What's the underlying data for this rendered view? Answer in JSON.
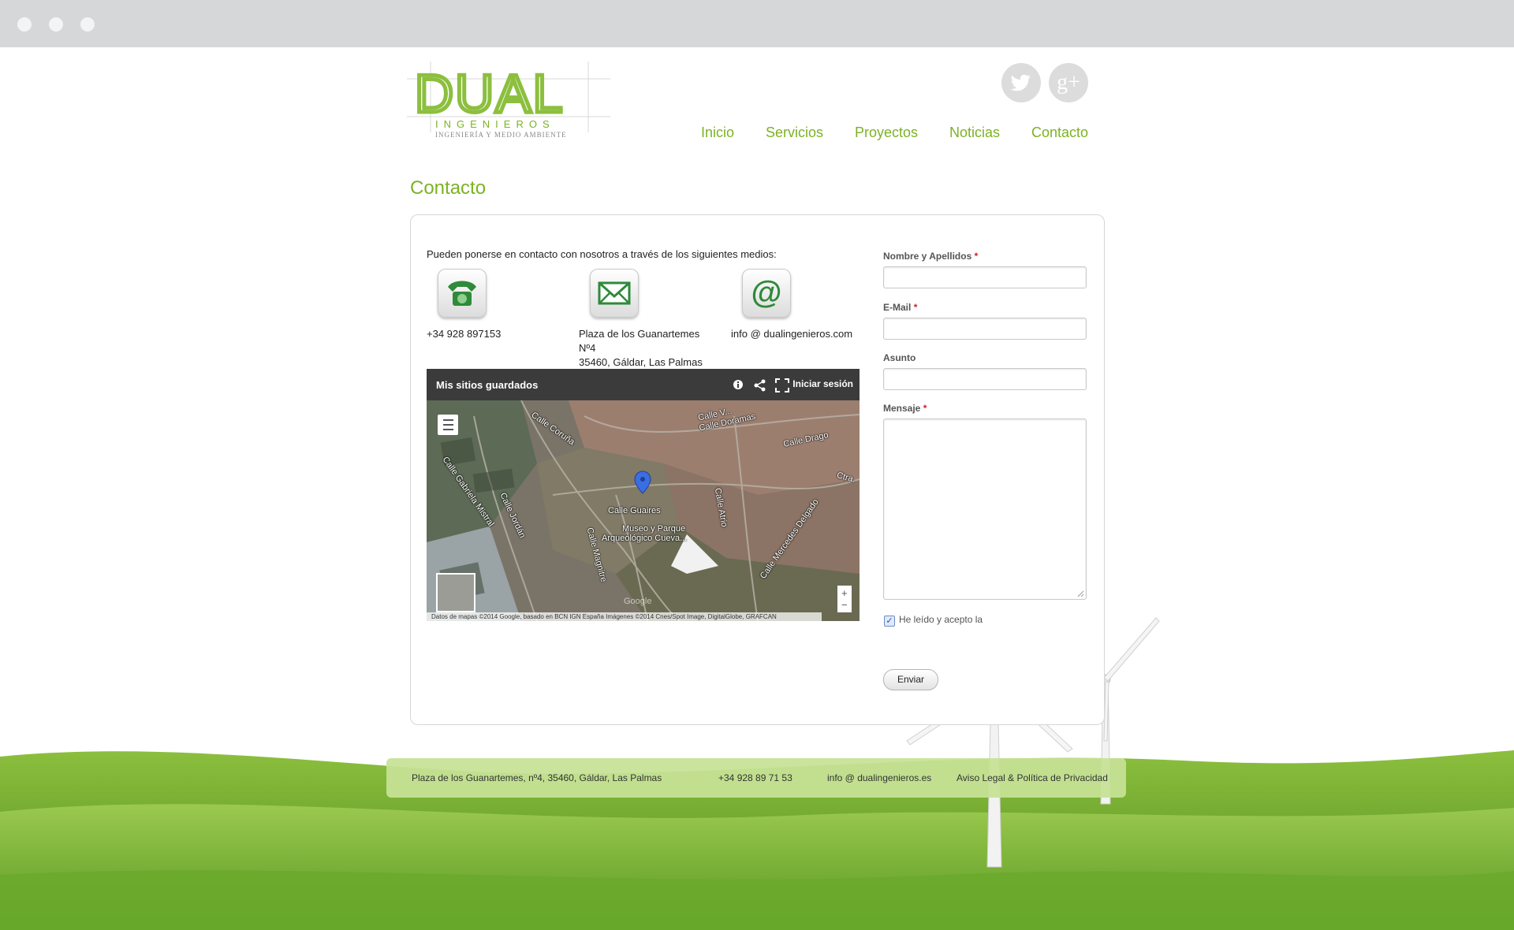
{
  "header": {
    "logo_text": "DUAL",
    "logo_subtitle": "INGENIEROS",
    "logo_tagline": "INGENIERÍA Y MEDIO AMBIENTE",
    "social": [
      {
        "name": "twitter-icon"
      },
      {
        "name": "google-plus-icon",
        "label": "g+"
      }
    ],
    "nav": [
      {
        "label": "Inicio"
      },
      {
        "label": "Servicios"
      },
      {
        "label": "Proyectos"
      },
      {
        "label": "Noticias"
      },
      {
        "label": "Contacto"
      }
    ]
  },
  "page": {
    "title": "Contacto",
    "intro": "Pueden ponerse en contacto con nosotros a través de los siguientes medios:",
    "contacts": {
      "phone": "+34 928 897153",
      "address_line1": "Plaza de los Guanartemes",
      "address_line2": "Nº4",
      "address_line3": "35460, Gáldar, Las Palmas",
      "email": "info @ dualingenieros.com"
    }
  },
  "map": {
    "title": "Mis sitios guardados",
    "signin": "Iniciar sesión",
    "labels": {
      "calle_coruna": "Calle Coruña",
      "calle_doramas": "Calle Doramas",
      "calle_drago": "Calle Drago",
      "calle_gabriela_mistral": "Calle Gabriela Mistral",
      "calle_jordan": "Calle Jordán",
      "calle_guaires": "Calle Guaires",
      "museo_1": "Museo y Parque",
      "museo_2": "Arqueológico Cueva...",
      "calle_magnitre": "Calle Magnitre",
      "calle_mercedes": "Calle Mercedes Delgado",
      "calle_atrio": "Calle Atrio",
      "calle_v": "Calle V...",
      "carr": "Ctra."
    },
    "attribution": "Datos de mapas ©2014 Google, basado en BCN IGN España Imágenes ©2014 Cnes/Spot Image, DigitalGlobe, GRAFCAN",
    "google": "Google",
    "zoom_in": "+",
    "zoom_out": "−"
  },
  "form": {
    "name_label": "Nombre y Apellidos",
    "email_label": "E-Mail",
    "subject_label": "Asunto",
    "message_label": "Mensaje",
    "required_mark": "*",
    "accept_label": "He leído y acepto la",
    "accept_checked": true,
    "submit_label": "Enviar"
  },
  "footer": {
    "address": "Plaza de los Guanartemes, nº4, 35460, Gáldar, Las Palmas",
    "phone": "+34 928 89 71 53",
    "email": "info @ dualingenieros.es",
    "legal": "Aviso Legal & Política de Privacidad"
  },
  "colors": {
    "brand_green": "#7cb225",
    "footer_bg": "#c6e296",
    "chrome": "#d6d7d9"
  }
}
